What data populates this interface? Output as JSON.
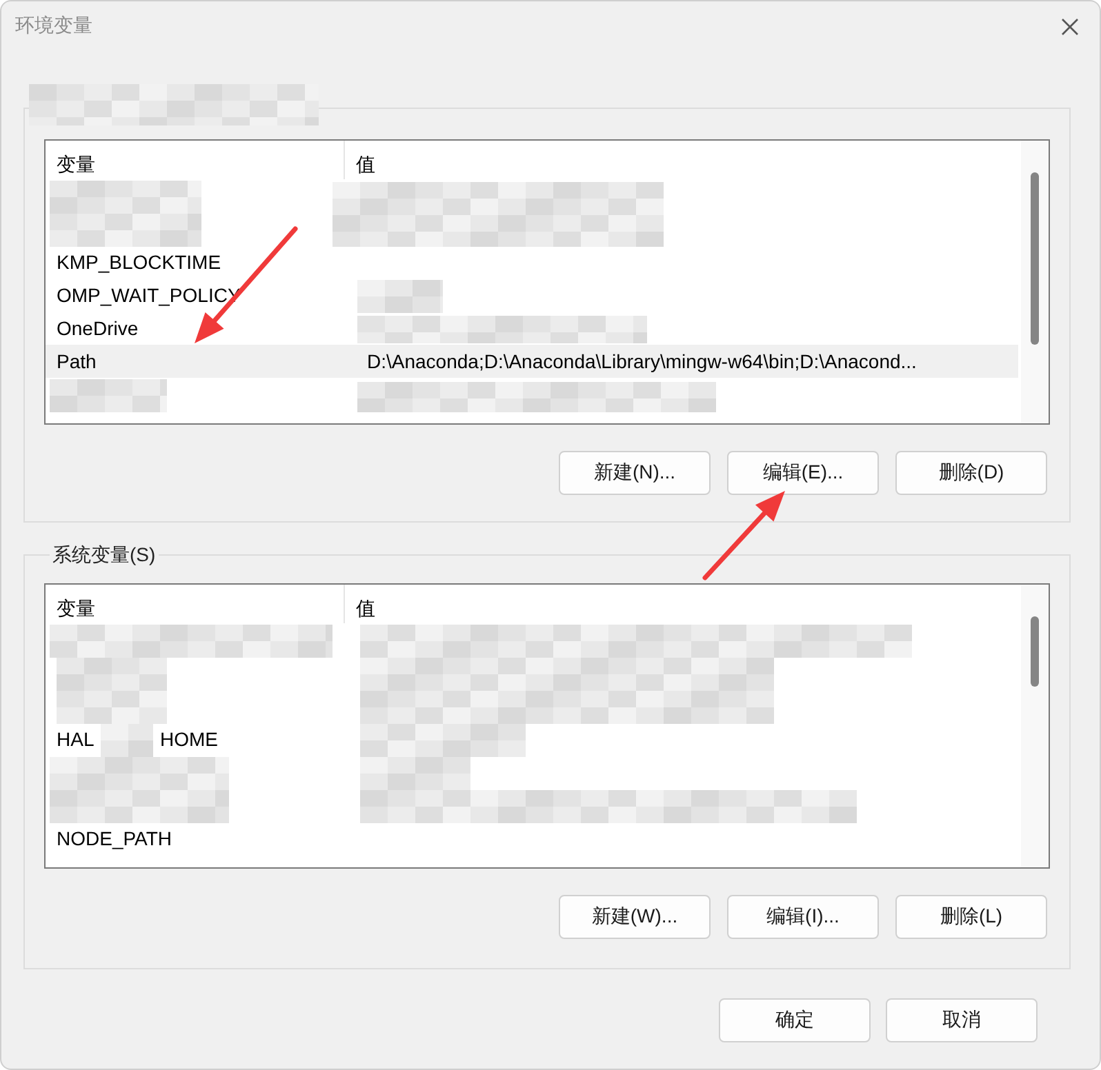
{
  "window": {
    "title": "环境变量"
  },
  "user_variables": {
    "columns": [
      "变量",
      "值"
    ],
    "rows": [
      {
        "kind": "redacted"
      },
      {
        "kind": "redacted"
      },
      {
        "kind": "text",
        "name": "KMP_BLOCKTIME",
        "selected": false
      },
      {
        "kind": "text",
        "name": "OMP_WAIT_POLICY",
        "selected": false
      },
      {
        "kind": "text",
        "name": "OneDrive",
        "selected": false
      },
      {
        "kind": "text",
        "name": "Path",
        "value": "D:\\Anaconda;D:\\Anaconda\\Library\\mingw-w64\\bin;D:\\Anacond...",
        "selected": true
      },
      {
        "kind": "redacted"
      }
    ],
    "buttons": [
      "新建(N)...",
      "编辑(E)...",
      "删除(D)"
    ]
  },
  "system_variables": {
    "title": "系统变量(S)",
    "columns": [
      "变量",
      "值"
    ],
    "rows": [
      {
        "kind": "redacted"
      },
      {
        "kind": "redacted"
      },
      {
        "kind": "redacted"
      },
      {
        "kind": "partial",
        "name_parts": [
          "HAL",
          "HOME"
        ],
        "selected": false
      },
      {
        "kind": "redacted"
      },
      {
        "kind": "redacted"
      },
      {
        "kind": "text",
        "name": "NODE_PATH",
        "selected": false
      }
    ],
    "buttons": [
      "新建(W)...",
      "编辑(I)...",
      "删除(L)"
    ]
  },
  "footer_buttons": [
    "确定",
    "取消"
  ]
}
